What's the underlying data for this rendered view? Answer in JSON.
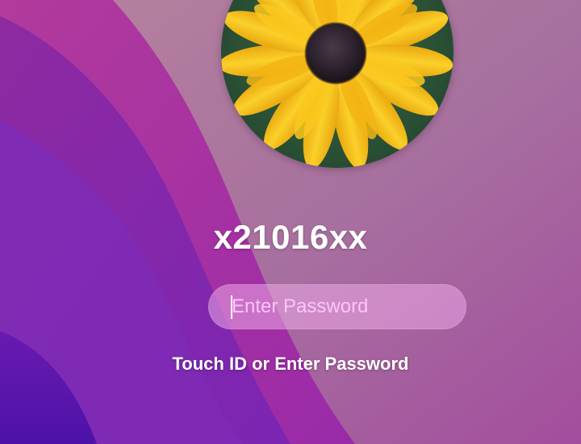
{
  "wallpaper": {
    "colors": {
      "base": "#a56f9e",
      "deep_purple": "#5a1aa0",
      "magenta": "#b0289a",
      "violet": "#7a2ab0"
    }
  },
  "avatar": {
    "icon": "sunflower-avatar-icon",
    "colors": {
      "petal": "#f7c21b",
      "center": "#2a1f2a",
      "leaf": "#2d5a3a"
    }
  },
  "user": {
    "name": "x21016xx"
  },
  "password": {
    "placeholder": "Enter Password",
    "value": ""
  },
  "hint": {
    "text": "Touch ID or Enter Password"
  }
}
